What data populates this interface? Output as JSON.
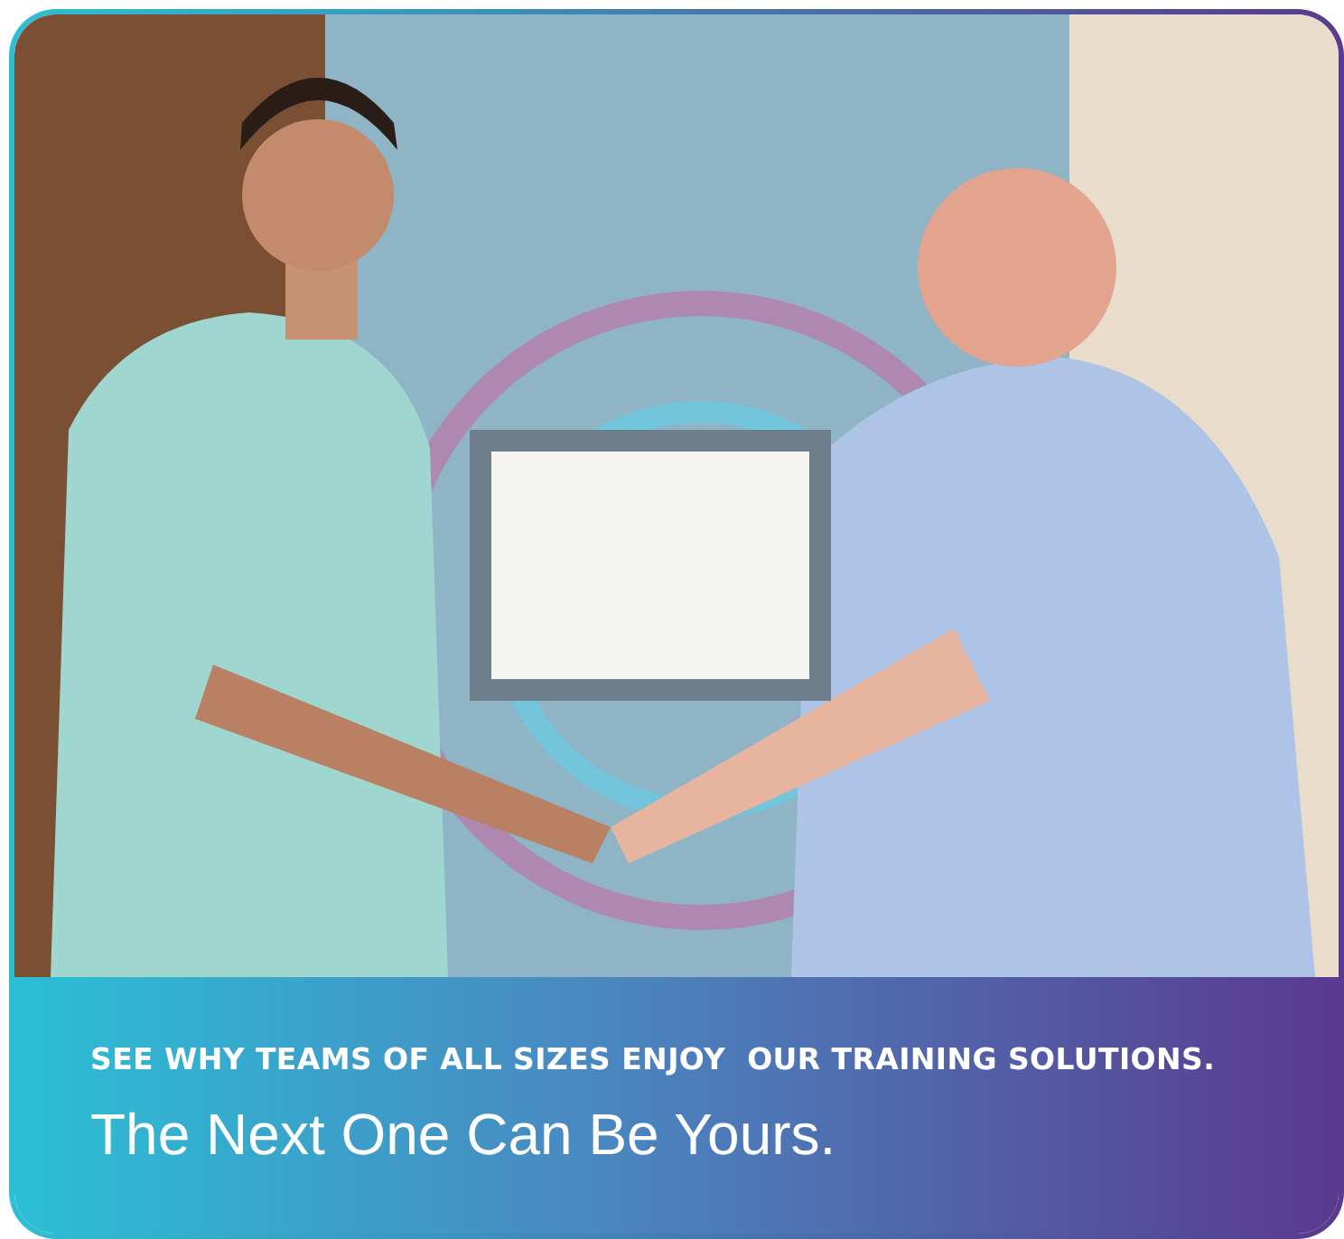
{
  "card": {
    "tagline": "SEE WHY TEAMS OF ALL SIZES ENJOY  OUR TRAINING SOLUTIONS.",
    "headline": "The Next One Can Be Yours."
  }
}
